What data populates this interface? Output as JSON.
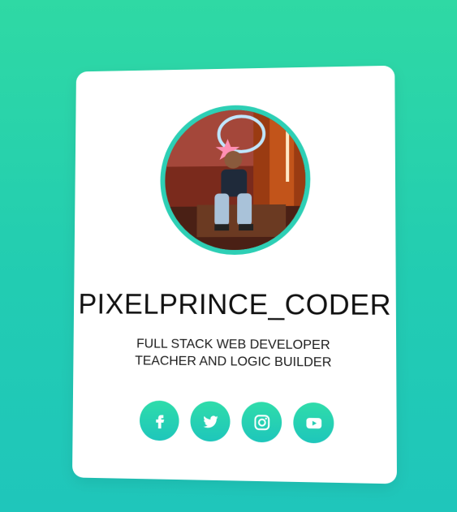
{
  "profile": {
    "name": "PIXELPRINCE_CODER",
    "tagline_line1": "FULL STACK WEB DEVELOPER",
    "tagline_line2": "TEACHER AND LOGIC BUILDER"
  },
  "socials": [
    {
      "icon": "facebook-icon"
    },
    {
      "icon": "twitter-icon"
    },
    {
      "icon": "instagram-icon"
    },
    {
      "icon": "youtube-icon"
    }
  ],
  "colors": {
    "background_top": "#2fd9a4",
    "background_bottom": "#1fc6bb",
    "accent": "#2dcfb5",
    "card": "#ffffff"
  }
}
